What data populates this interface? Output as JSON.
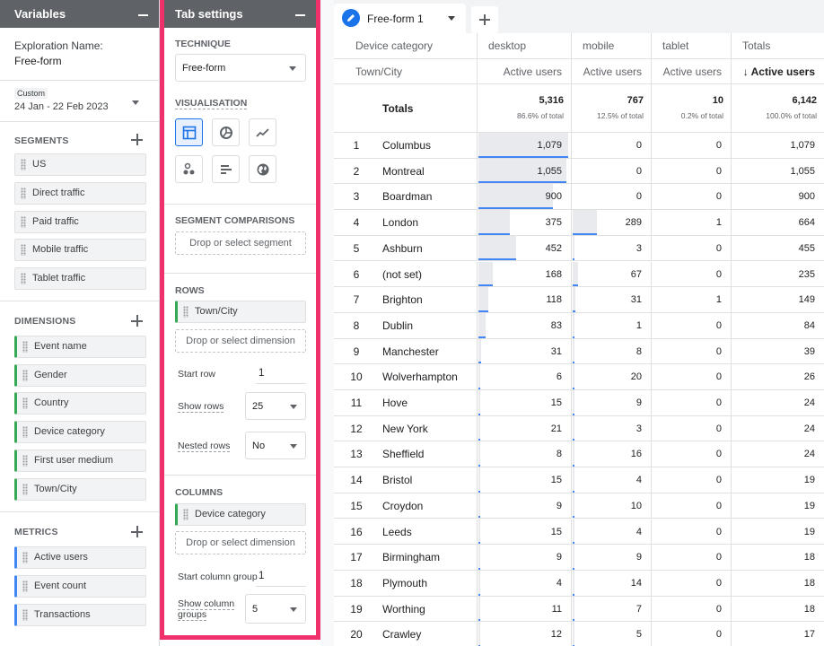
{
  "variables": {
    "title": "Variables",
    "exploration_label": "Exploration Name:",
    "exploration_name": "Free-form",
    "date_tag": "Custom",
    "date_range": "24 Jan - 22 Feb 2023",
    "segments_title": "SEGMENTS",
    "segments": [
      "US",
      "Direct traffic",
      "Paid traffic",
      "Mobile traffic",
      "Tablet traffic"
    ],
    "dimensions_title": "DIMENSIONS",
    "dimensions": [
      "Event name",
      "Gender",
      "Country",
      "Device category",
      "First user medium",
      "Town/City"
    ],
    "metrics_title": "METRICS",
    "metrics": [
      "Active users",
      "Event count",
      "Transactions"
    ]
  },
  "tab_settings": {
    "title": "Tab settings",
    "technique_label": "TECHNIQUE",
    "technique_value": "Free-form",
    "visualisation_label": "VISUALISATION",
    "visualisation_icons": [
      "table-icon",
      "donut-chart-icon",
      "line-chart-icon",
      "scatter-icon",
      "bar-chart-icon",
      "geo-map-icon"
    ],
    "segment_comparisons_label": "SEGMENT COMPARISONS",
    "segment_drop": "Drop or select segment",
    "rows_label": "ROWS",
    "rows_dimension": "Town/City",
    "rows_drop": "Drop or select dimension",
    "start_row_label": "Start row",
    "start_row_value": "1",
    "show_rows_label": "Show rows",
    "show_rows_value": "25",
    "nested_rows_label": "Nested rows",
    "nested_rows_value": "No",
    "columns_label": "COLUMNS",
    "columns_dimension": "Device category",
    "columns_drop": "Drop or select dimension",
    "start_col_group_label": "Start column group",
    "start_col_group_value": "1",
    "show_col_groups_label_1": "Show column",
    "show_col_groups_label_2": "groups",
    "show_col_groups_value": "5"
  },
  "canvas": {
    "tab_name": "Free-form 1",
    "header_dimension": "Device category",
    "header_row_dimension": "Town/City",
    "columns": [
      "desktop",
      "mobile",
      "tablet",
      "Totals"
    ],
    "metric": "Active users",
    "metric_sorted": "↓ Active users",
    "totals_label": "Totals",
    "totals": [
      "5,316",
      "767",
      "10",
      "6,142"
    ],
    "totals_pct": [
      "86.6% of total",
      "12.5% of total",
      "0.2% of total",
      "100.0% of total"
    ],
    "accent": "#4285f4",
    "rows": [
      {
        "i": "1",
        "city": "Columbus",
        "desktop": "1,079",
        "mobile": "0",
        "tablet": "0",
        "total": "1,079"
      },
      {
        "i": "2",
        "city": "Montreal",
        "desktop": "1,055",
        "mobile": "0",
        "tablet": "0",
        "total": "1,055"
      },
      {
        "i": "3",
        "city": "Boardman",
        "desktop": "900",
        "mobile": "0",
        "tablet": "0",
        "total": "900"
      },
      {
        "i": "4",
        "city": "London",
        "desktop": "375",
        "mobile": "289",
        "tablet": "1",
        "total": "664"
      },
      {
        "i": "5",
        "city": "Ashburn",
        "desktop": "452",
        "mobile": "3",
        "tablet": "0",
        "total": "455"
      },
      {
        "i": "6",
        "city": "(not set)",
        "desktop": "168",
        "mobile": "67",
        "tablet": "0",
        "total": "235"
      },
      {
        "i": "7",
        "city": "Brighton",
        "desktop": "118",
        "mobile": "31",
        "tablet": "1",
        "total": "149"
      },
      {
        "i": "8",
        "city": "Dublin",
        "desktop": "83",
        "mobile": "1",
        "tablet": "0",
        "total": "84"
      },
      {
        "i": "9",
        "city": "Manchester",
        "desktop": "31",
        "mobile": "8",
        "tablet": "0",
        "total": "39"
      },
      {
        "i": "10",
        "city": "Wolverhampton",
        "desktop": "6",
        "mobile": "20",
        "tablet": "0",
        "total": "26"
      },
      {
        "i": "11",
        "city": "Hove",
        "desktop": "15",
        "mobile": "9",
        "tablet": "0",
        "total": "24"
      },
      {
        "i": "12",
        "city": "New York",
        "desktop": "21",
        "mobile": "3",
        "tablet": "0",
        "total": "24"
      },
      {
        "i": "13",
        "city": "Sheffield",
        "desktop": "8",
        "mobile": "16",
        "tablet": "0",
        "total": "24"
      },
      {
        "i": "14",
        "city": "Bristol",
        "desktop": "15",
        "mobile": "4",
        "tablet": "0",
        "total": "19"
      },
      {
        "i": "15",
        "city": "Croydon",
        "desktop": "9",
        "mobile": "10",
        "tablet": "0",
        "total": "19"
      },
      {
        "i": "16",
        "city": "Leeds",
        "desktop": "15",
        "mobile": "4",
        "tablet": "0",
        "total": "19"
      },
      {
        "i": "17",
        "city": "Birmingham",
        "desktop": "9",
        "mobile": "9",
        "tablet": "0",
        "total": "18"
      },
      {
        "i": "18",
        "city": "Plymouth",
        "desktop": "4",
        "mobile": "14",
        "tablet": "0",
        "total": "18"
      },
      {
        "i": "19",
        "city": "Worthing",
        "desktop": "11",
        "mobile": "7",
        "tablet": "0",
        "total": "18"
      },
      {
        "i": "20",
        "city": "Crawley",
        "desktop": "12",
        "mobile": "5",
        "tablet": "0",
        "total": "17"
      }
    ]
  }
}
